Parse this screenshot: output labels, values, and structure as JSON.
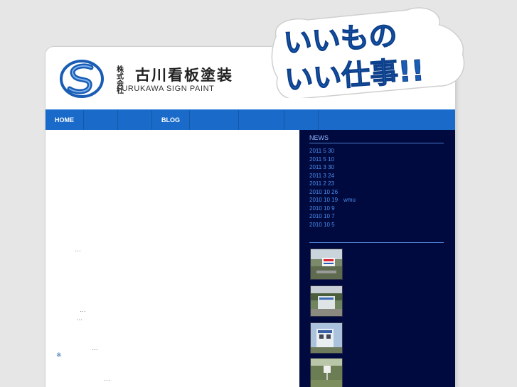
{
  "header": {
    "company_small": "株式会社",
    "company_name": "古川看板塗装",
    "company_en": "FURUKAWA SIGN PAINT"
  },
  "badge": {
    "line1": "いいもの",
    "line2": "いい仕事!!"
  },
  "nav": {
    "items": [
      "HOME",
      "",
      "",
      "BLOG",
      "",
      "",
      "",
      ""
    ]
  },
  "main": {
    "dots": [
      "…",
      "…",
      "…",
      "…",
      "…"
    ],
    "asterisk": "※"
  },
  "sidebar": {
    "news_title": "NEWS",
    "news": [
      "2011 5 30",
      "2011 5 10",
      "2011 3 30",
      "2011 3 24",
      "2011 2 23",
      "2010 10 26",
      "2010 10 19　wmu",
      "2010 10 9",
      "2010 10 7",
      "2010 10 5"
    ]
  },
  "colors": {
    "nav_blue": "#1a6ac9",
    "sidebar_navy": "#000a3e",
    "link_blue": "#4d8df0",
    "badge_blue": "#1a5db5"
  }
}
